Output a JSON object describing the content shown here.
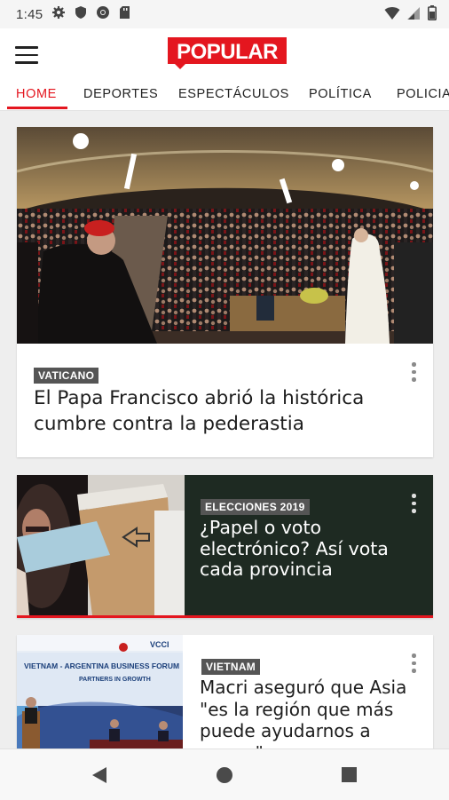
{
  "status_bar": {
    "time": "1:45"
  },
  "app": {
    "logo_text": "POPULAR"
  },
  "tabs": [
    "HOME",
    "DEPORTES",
    "ESPECTÁCULOS",
    "POLÍTICA",
    "POLICIA"
  ],
  "articles": [
    {
      "tag": "VATICANO",
      "title_line1": "El Papa Francisco abrió la histórica",
      "title_line2": "cumbre contra la pederastia"
    },
    {
      "tag": "ELECCIONES 2019",
      "title_line1": "¿Papel o voto",
      "title_line2": "electrónico? Así vota",
      "title_line3": "cada provincia"
    },
    {
      "tag": "VIETNAM",
      "title_line1": "Macri aseguró que Asia",
      "title_line2": "\"es la región que más",
      "title_line3": "puede ayudarnos a",
      "title_line4": "crecer\""
    }
  ],
  "photo3_texts": {
    "banner": "VIETNAM - ARGENTINA BUSINESS FORUM",
    "sub": "PARTNERS IN GROWTH",
    "brand": "VCCI"
  },
  "colors": {
    "accent": "#e4161f",
    "dark_card": "#1e2a22"
  },
  "icons": [
    "settings-icon",
    "shield-icon",
    "chrome-icon",
    "sd-card-icon",
    "wifi-icon",
    "signal-icon",
    "battery-icon",
    "menu-icon",
    "more-vert-icon",
    "back-icon",
    "home-icon",
    "recents-icon"
  ]
}
